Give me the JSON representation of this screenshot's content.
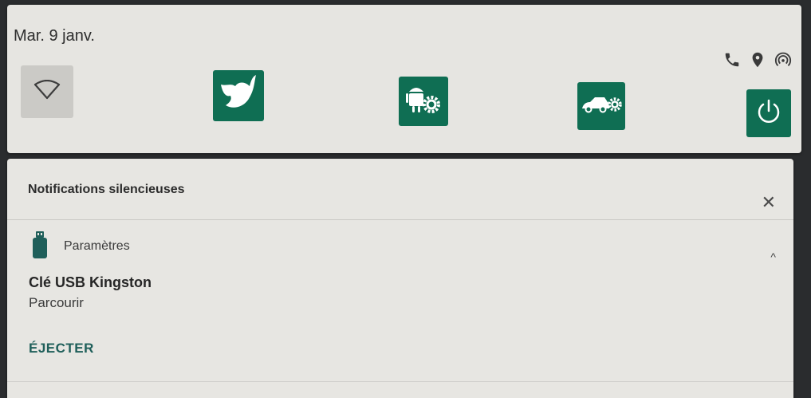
{
  "quick_settings": {
    "date": "Mar. 9 janv.",
    "tiles": [
      {
        "name": "wifi",
        "icon": "wifi-icon",
        "active": false
      },
      {
        "name": "cleaner-app",
        "icon": "brush-leaf-icon",
        "active": true
      },
      {
        "name": "android-settings",
        "icon": "android-gear-icon",
        "active": true
      },
      {
        "name": "car-settings",
        "icon": "car-gear-icon",
        "active": true
      },
      {
        "name": "power",
        "icon": "power-icon",
        "active": true
      }
    ],
    "status_icons": [
      "phone-icon",
      "location-icon",
      "hotspot-icon"
    ]
  },
  "notifications": {
    "section_title": "Notifications silencieuses",
    "close_icon": "close-icon",
    "items": [
      {
        "app_name": "Paramètres",
        "app_icon": "usb-stick-icon",
        "title": "Clé USB Kingston",
        "text": "Parcourir",
        "action": "ÉJECTER"
      }
    ]
  },
  "colors": {
    "tile_green": "#0f6e53",
    "panel_bg": "#e6e5e1",
    "action_text": "#1f5f5a"
  }
}
